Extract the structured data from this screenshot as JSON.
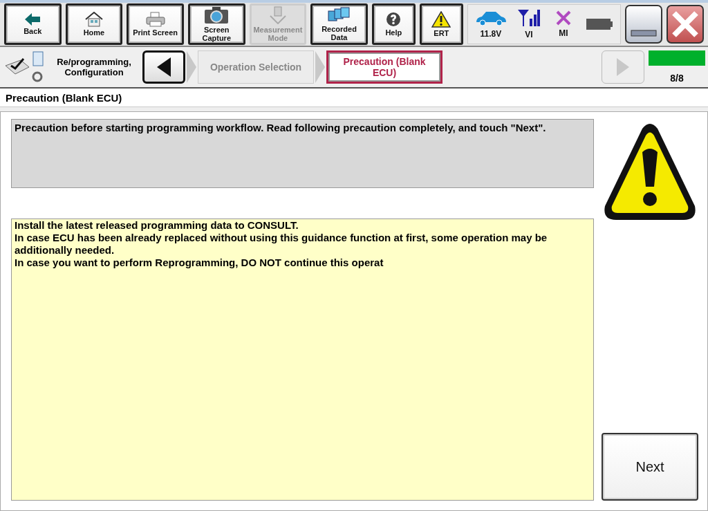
{
  "toolbar": {
    "buttons": [
      {
        "label": "Back",
        "disabled": false
      },
      {
        "label": "Home",
        "disabled": false
      },
      {
        "label": "Print Screen",
        "disabled": false
      },
      {
        "label": "Screen Capture",
        "disabled": false
      },
      {
        "label": "Measurement Mode",
        "disabled": true
      },
      {
        "label": "Recorded Data",
        "disabled": false
      },
      {
        "label": "Help",
        "disabled": false
      },
      {
        "label": "ERT",
        "disabled": false
      }
    ],
    "status": {
      "voltage": "11.8V",
      "vi": "VI",
      "mi": "MI"
    }
  },
  "breadcrumb": {
    "section": "Re/programming, Configuration",
    "steps": [
      {
        "label": "Operation Selection",
        "selected": false
      },
      {
        "label": "Precaution (Blank ECU)",
        "selected": true
      }
    ],
    "progress": {
      "level": 1,
      "text": "8/8"
    }
  },
  "page_title": "Precaution (Blank ECU)",
  "instruction": "Precaution before starting programming workflow. Read following precaution completely, and touch \"Next\".",
  "precautions": [
    "Install the latest released programming data to CONSULT.",
    "In case ECU has been already replaced without using this guidance function at first, some operation may be additionally needed.",
    "In case you want to perform Reprogramming, DO NOT continue this operat"
  ],
  "next_button": "Next"
}
